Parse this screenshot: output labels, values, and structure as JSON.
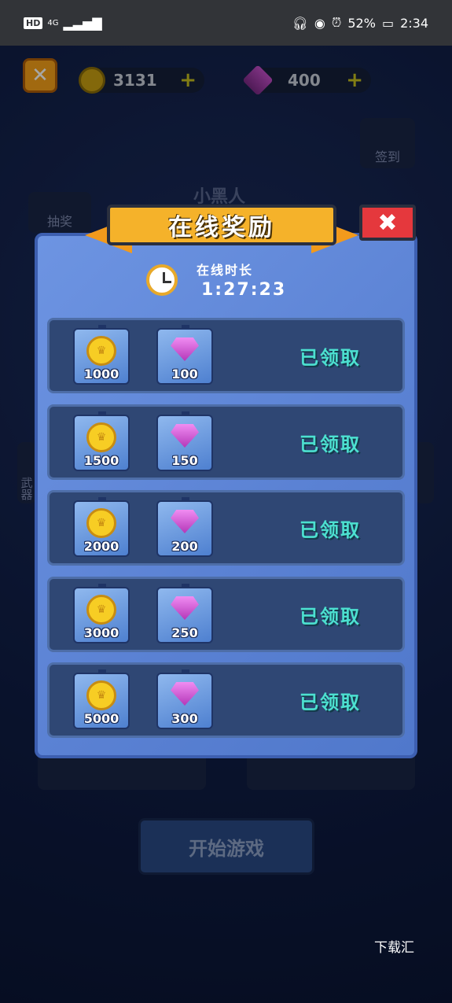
{
  "status_bar": {
    "hd": "HD",
    "network": "4G",
    "battery": "52%",
    "time": "2:34"
  },
  "currency": {
    "coins": "3131",
    "gems": "400",
    "plus": "+"
  },
  "background": {
    "signin_label": "签到",
    "lottery_label": "抽奖",
    "player_name": "小黑人",
    "weapon_label": "武器",
    "start_game": "开始游戏"
  },
  "dialog": {
    "title": "在线奖励",
    "close_symbol": "✖",
    "online_label": "在线时长",
    "online_time": "1:27:23",
    "rewards": [
      {
        "coins": "1000",
        "gems": "100",
        "status": "已领取"
      },
      {
        "coins": "1500",
        "gems": "150",
        "status": "已领取"
      },
      {
        "coins": "2000",
        "gems": "200",
        "status": "已领取"
      },
      {
        "coins": "3000",
        "gems": "250",
        "status": "已领取"
      },
      {
        "coins": "5000",
        "gems": "300",
        "status": "已领取"
      }
    ]
  },
  "watermark": "下载汇"
}
